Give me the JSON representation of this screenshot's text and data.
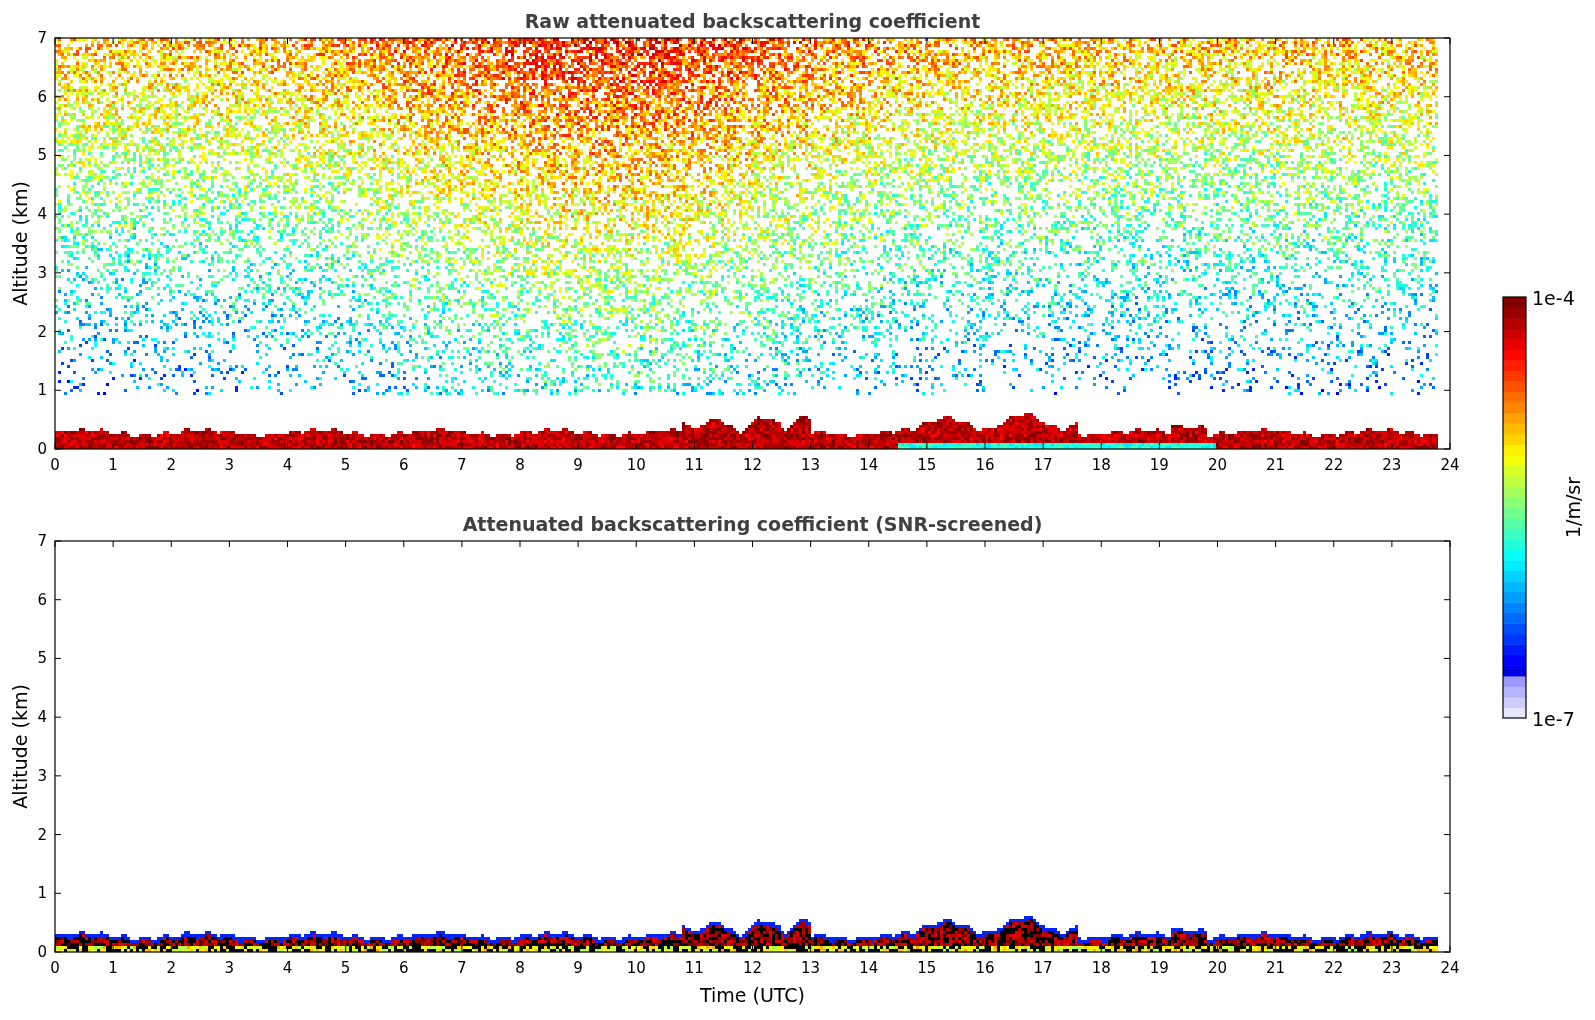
{
  "panels": [
    {
      "title": "Raw attenuated backscattering coefficient",
      "kind": "raw",
      "ylabel": "Altitude (km)",
      "yticks": [
        "7",
        "6",
        "5",
        "4",
        "3",
        "2",
        "1",
        "0"
      ],
      "xticks": [
        "0",
        "1",
        "2",
        "3",
        "4",
        "5",
        "6",
        "7",
        "8",
        "9",
        "10",
        "11",
        "12",
        "13",
        "14",
        "15",
        "16",
        "17",
        "18",
        "19",
        "20",
        "21",
        "22",
        "23",
        "24"
      ]
    },
    {
      "title": "Attenuated backscattering coefficient (SNR-screened)",
      "kind": "screened",
      "ylabel": "Altitude (km)",
      "yticks": [
        "7",
        "6",
        "5",
        "4",
        "3",
        "2",
        "1",
        "0"
      ],
      "xticks": [
        "0",
        "1",
        "2",
        "3",
        "4",
        "5",
        "6",
        "7",
        "8",
        "9",
        "10",
        "11",
        "12",
        "13",
        "14",
        "15",
        "16",
        "17",
        "18",
        "19",
        "20",
        "21",
        "22",
        "23",
        "24"
      ],
      "xlabel": "Time (UTC)"
    }
  ],
  "colorbar": {
    "max_label": "1e-4",
    "min_label": "1e-7",
    "unit": "1/m/sr"
  }
}
